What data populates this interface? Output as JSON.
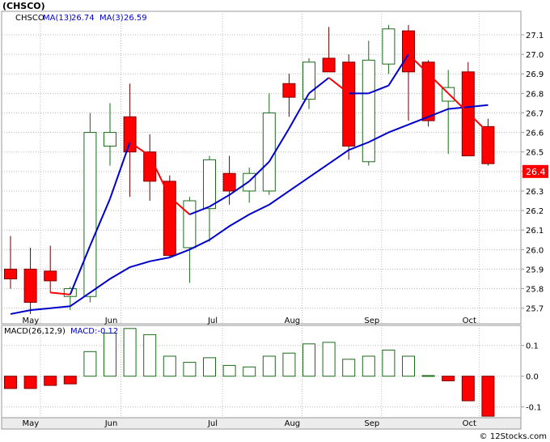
{
  "chart_data": [
    {
      "type": "candlestick",
      "symbol_label": "(CHSCO)",
      "legend": [
        {
          "label": "CHSCO",
          "color": "#000000"
        },
        {
          "label": "MA(13)",
          "value": "26.74",
          "color": "#0000cc"
        },
        {
          "label": "MA(3)",
          "value": "26.59",
          "color": "#0000cc"
        }
      ],
      "ylim": [
        25.62,
        27.22
      ],
      "yticks": [
        "25.7",
        "25.8",
        "25.9",
        "26.0",
        "26.1",
        "26.2",
        "26.3",
        "26.4",
        "26.5",
        "26.6",
        "26.7",
        "26.8",
        "26.9",
        "27.0",
        "27.1"
      ],
      "last_price_label": "26.4",
      "x_labels": [
        {
          "label": "May",
          "index": 1
        },
        {
          "label": "Jun",
          "index": 5.05
        },
        {
          "label": "Jul",
          "index": 10.15
        },
        {
          "label": "Aug",
          "index": 14.15
        },
        {
          "label": "Sep",
          "index": 18.15
        },
        {
          "label": "Oct",
          "index": 23.05
        }
      ],
      "candles": [
        {
          "o": 25.9,
          "h": 26.07,
          "l": 25.8,
          "c": 25.85
        },
        {
          "o": 25.9,
          "h": 26.01,
          "l": 25.67,
          "c": 25.73
        },
        {
          "o": 25.89,
          "h": 26.02,
          "l": 25.78,
          "c": 25.84
        },
        {
          "o": 25.76,
          "h": 25.81,
          "l": 25.69,
          "c": 25.8
        },
        {
          "o": 25.76,
          "h": 26.7,
          "l": 25.73,
          "c": 26.6
        },
        {
          "o": 26.53,
          "h": 26.75,
          "l": 26.43,
          "c": 26.6
        },
        {
          "o": 26.68,
          "h": 26.85,
          "l": 26.27,
          "c": 26.5
        },
        {
          "o": 26.5,
          "h": 26.59,
          "l": 26.25,
          "c": 26.35
        },
        {
          "o": 26.35,
          "h": 26.38,
          "l": 25.96,
          "c": 25.97
        },
        {
          "o": 26.01,
          "h": 26.27,
          "l": 25.83,
          "c": 26.25
        },
        {
          "o": 26.21,
          "h": 26.48,
          "l": 26.04,
          "c": 26.46
        },
        {
          "o": 26.39,
          "h": 26.48,
          "l": 26.23,
          "c": 26.3
        },
        {
          "o": 26.3,
          "h": 26.42,
          "l": 26.24,
          "c": 26.39
        },
        {
          "o": 26.3,
          "h": 26.8,
          "l": 26.28,
          "c": 26.7
        },
        {
          "o": 26.85,
          "h": 26.9,
          "l": 26.68,
          "c": 26.78
        },
        {
          "o": 26.77,
          "h": 26.98,
          "l": 26.72,
          "c": 26.96
        },
        {
          "o": 26.98,
          "h": 27.14,
          "l": 26.93,
          "c": 26.91
        },
        {
          "o": 26.96,
          "h": 27.0,
          "l": 26.46,
          "c": 26.53
        },
        {
          "o": 26.45,
          "h": 27.07,
          "l": 26.43,
          "c": 26.97
        },
        {
          "o": 26.95,
          "h": 27.15,
          "l": 26.9,
          "c": 27.13
        },
        {
          "o": 27.12,
          "h": 27.15,
          "l": 26.66,
          "c": 26.91
        },
        {
          "o": 26.96,
          "h": 26.97,
          "l": 26.63,
          "c": 26.66
        },
        {
          "o": 26.76,
          "h": 26.92,
          "l": 26.49,
          "c": 26.83
        },
        {
          "o": 26.91,
          "h": 26.96,
          "l": 26.48,
          "c": 26.48
        },
        {
          "o": 26.63,
          "h": 26.67,
          "l": 26.43,
          "c": 26.44
        }
      ],
      "ma3": [
        null,
        null,
        25.78,
        25.77,
        26.02,
        26.26,
        26.55,
        26.48,
        26.27,
        26.18,
        26.22,
        26.28,
        26.35,
        26.45,
        26.62,
        26.8,
        26.88,
        26.8,
        26.8,
        26.84,
        27.0,
        26.9,
        26.8,
        26.7,
        26.6
      ],
      "ma13": [
        25.67,
        25.69,
        25.7,
        25.71,
        25.78,
        25.85,
        25.91,
        25.94,
        25.96,
        26.0,
        26.05,
        26.12,
        26.18,
        26.23,
        26.3,
        26.37,
        26.44,
        26.51,
        26.55,
        26.6,
        26.64,
        26.68,
        26.72,
        26.73,
        26.74
      ]
    },
    {
      "type": "bar",
      "title": "MACD(26,12,9)",
      "value_label": "MACD:-0.12",
      "ylim": [
        -0.135,
        0.165
      ],
      "yticks": [
        "0.1",
        "0.0",
        "-0.1"
      ],
      "values": [
        -0.04,
        -0.04,
        -0.03,
        -0.025,
        0.08,
        0.14,
        0.155,
        0.135,
        0.065,
        0.045,
        0.06,
        0.035,
        0.03,
        0.065,
        0.075,
        0.105,
        0.11,
        0.055,
        0.065,
        0.085,
        0.065,
        0.002,
        -0.015,
        -0.08,
        -0.13
      ]
    }
  ],
  "footer": {
    "credit": "© 12Stocks.com"
  }
}
